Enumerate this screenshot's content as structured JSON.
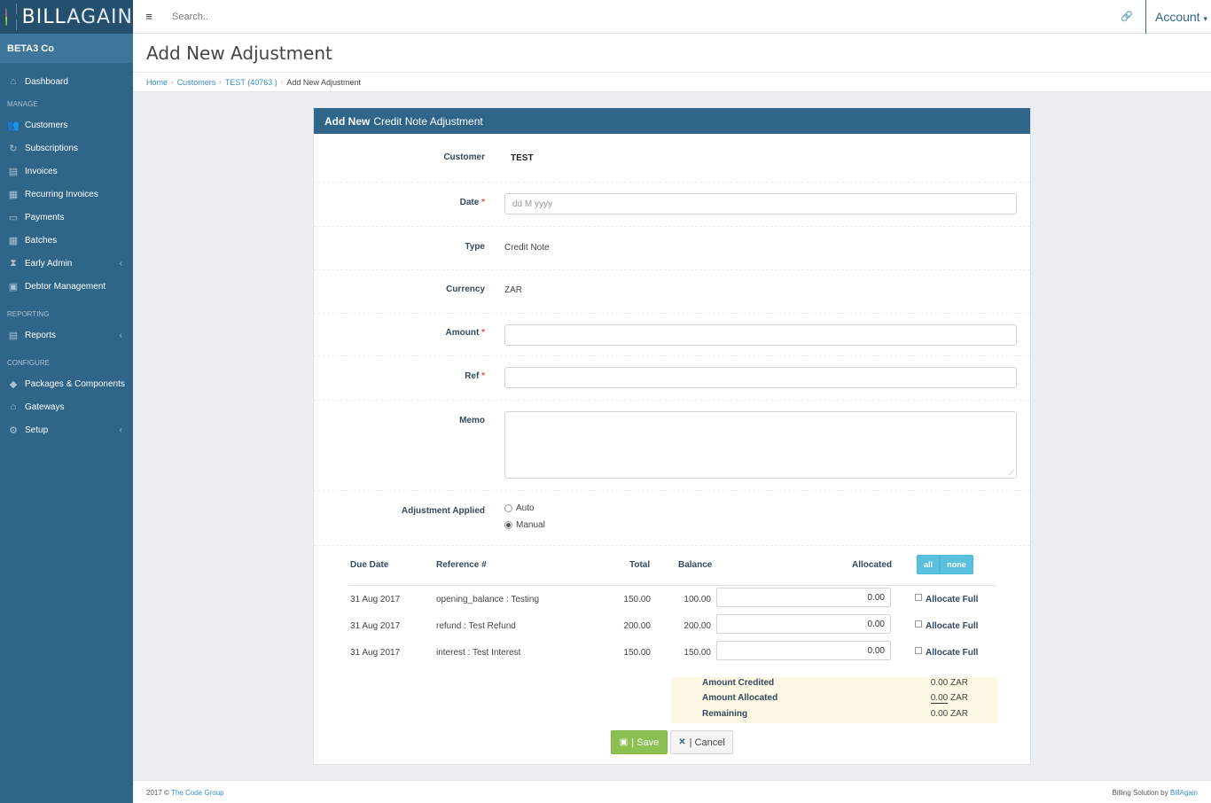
{
  "brand": {
    "logo_text_bold": "BILL",
    "logo_text_light": "AGAIN",
    "company": "BETA3 Co"
  },
  "topbar": {
    "search_placeholder": "Search..",
    "account_label": "Account"
  },
  "sidebar": {
    "dashboard": "Dashboard",
    "manage_head": "MANAGE",
    "manage": [
      "Customers",
      "Subscriptions",
      "Invoices",
      "Recurring Invoices",
      "Payments",
      "Batches",
      "Early Admin",
      "Debtor Management"
    ],
    "reporting_head": "REPORTING",
    "reporting": [
      "Reports"
    ],
    "configure_head": "CONFIGURE",
    "configure": [
      "Packages & Components",
      "Gateways",
      "Setup"
    ]
  },
  "page": {
    "title": "Add New Adjustment"
  },
  "breadcrumb": {
    "home": "Home",
    "customers": "Customers",
    "customer": "TEST (40763 )",
    "current": "Add New Adjustment"
  },
  "panel": {
    "title_bold": "Add New",
    "title_rest": "Credit Note Adjustment"
  },
  "form": {
    "customer_label": "Customer",
    "customer_value": "TEST",
    "date_label": "Date",
    "date_placeholder": "dd M yyyy",
    "type_label": "Type",
    "type_value": "Credit Note",
    "currency_label": "Currency",
    "currency_value": "ZAR",
    "amount_label": "Amount",
    "ref_label": "Ref",
    "memo_label": "Memo",
    "applied_label": "Adjustment Applied",
    "auto_label": "Auto",
    "manual_label": "Manual",
    "required_mark": "*"
  },
  "table": {
    "headers": {
      "due_date": "Due Date",
      "reference": "Reference #",
      "total": "Total",
      "balance": "Balance",
      "allocated": "Allocated"
    },
    "btn_all": "all",
    "btn_none": "none",
    "rows": [
      {
        "due": "31 Aug 2017",
        "ref": "opening_balance : Testing",
        "total": "150.00",
        "balance": "100.00",
        "allocated": "0.00",
        "full": "Allocate Full"
      },
      {
        "due": "31 Aug 2017",
        "ref": "refund : Test Refund",
        "total": "200.00",
        "balance": "200.00",
        "allocated": "0.00",
        "full": "Allocate Full"
      },
      {
        "due": "31 Aug 2017",
        "ref": "interest : Test Interest",
        "total": "150.00",
        "balance": "150.00",
        "allocated": "0.00",
        "full": "Allocate Full"
      }
    ]
  },
  "summary": {
    "credited_label": "Amount Credited",
    "credited_value": "0.00",
    "credited_ccy": "ZAR",
    "allocated_label": "Amount Allocated",
    "allocated_value": "0.00",
    "allocated_ccy": "ZAR",
    "remaining_label": "Remaining",
    "remaining_value": "0.00",
    "remaining_ccy": "ZAR"
  },
  "buttons": {
    "save": "| Save",
    "cancel": "| Cancel"
  },
  "footer": {
    "copyright": "2017 ©",
    "company_link": "The Code Group",
    "right_text": "Billing Solution by",
    "right_link": "BillAgain"
  }
}
